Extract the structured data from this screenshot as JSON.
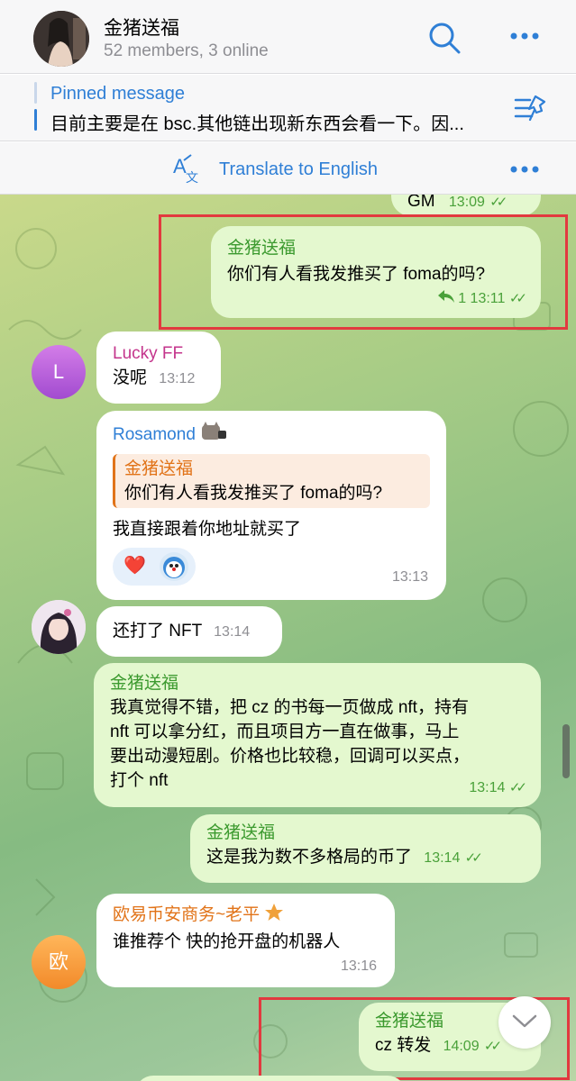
{
  "header": {
    "title": "金猪送福",
    "subtitle": "52 members, 3 online"
  },
  "pinned": {
    "title": "Pinned message",
    "text": "目前主要是在 bsc.其他链出现新东西会看一下。因..."
  },
  "translate": {
    "label": "Translate to English"
  },
  "messages": {
    "top_partial": {
      "text": "GM",
      "time": "13:09"
    },
    "m1": {
      "sender": "金猪送福",
      "text": "你们有人看我发推买了 foma的吗?",
      "reply_count": "1",
      "time": "13:11"
    },
    "m2": {
      "sender": "Lucky FF",
      "avatar_letter": "L",
      "text": "没呢",
      "time": "13:12"
    },
    "m3": {
      "sender": "Rosamond",
      "quote_sender": "金猪送福",
      "quote_text": "你们有人看我发推买了 foma的吗?",
      "text": "我直接跟着你地址就买了",
      "reaction1": "❤️",
      "time": "13:13"
    },
    "m4": {
      "text": "还打了 NFT",
      "time": "13:14"
    },
    "m5": {
      "sender": "金猪送福",
      "line1": "我真觉得不错，把 cz 的书每一页做成 nft，持有",
      "line2": "nft 可以拿分红，而且项目方一直在做事，马上",
      "line3": "要出动漫短剧。价格也比较稳，回调可以买点，",
      "line4": "打个 nft",
      "time": "13:14"
    },
    "m6": {
      "sender": "金猪送福",
      "text": "这是我为数不多格局的币了",
      "time": "13:14"
    },
    "m7": {
      "sender": "欧易币安商务~老平",
      "avatar_letter": "欧",
      "text": "谁推荐个  快的抢开盘的机器人",
      "time": "13:16"
    },
    "m8": {
      "sender": "金猪送福",
      "text": "cz 转发",
      "time": "14:09"
    }
  },
  "colors": {
    "accent": "#2f7fd6",
    "own_sender": "#3c9a2f",
    "highlight_box": "#e2393f",
    "outgoing_bubble": "#e4f8cf"
  },
  "icons": [
    "search-icon",
    "more-icon",
    "unpin-icon",
    "translate-icon",
    "reply-icon",
    "read-checks-icon",
    "scroll-down-icon"
  ]
}
